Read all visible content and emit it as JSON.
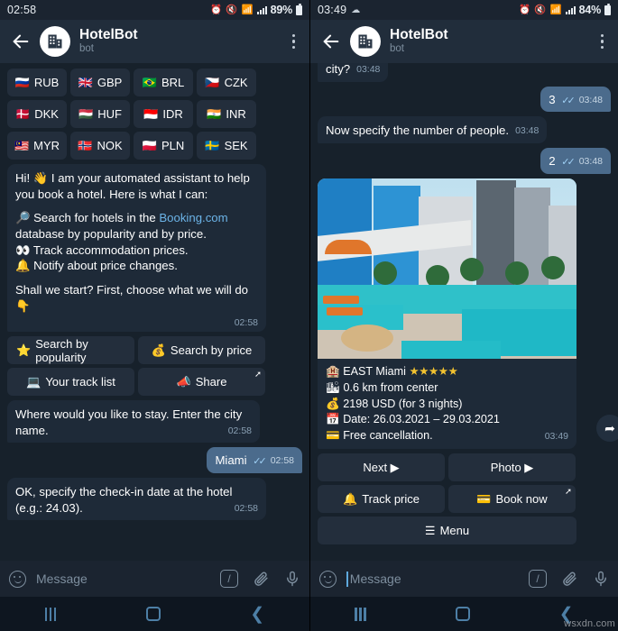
{
  "left": {
    "status_bar": {
      "clock": "02:58",
      "battery_pct": "89%",
      "icons": [
        "alarm-icon",
        "mute-icon",
        "wifi-icon",
        "signal-icon",
        "battery-icon"
      ]
    },
    "header": {
      "title": "HotelBot",
      "subtitle": "bot"
    },
    "currency_buttons": [
      {
        "flag": "🇷🇺",
        "label": "RUB"
      },
      {
        "flag": "🇬🇧",
        "label": "GBP"
      },
      {
        "flag": "🇧🇷",
        "label": "BRL"
      },
      {
        "flag": "🇨🇿",
        "label": "CZK"
      },
      {
        "flag": "🇩🇰",
        "label": "DKK"
      },
      {
        "flag": "🇭🇺",
        "label": "HUF"
      },
      {
        "flag": "🇮🇩",
        "label": "IDR"
      },
      {
        "flag": "🇮🇳",
        "label": "INR"
      },
      {
        "flag": "🇲🇾",
        "label": "MYR"
      },
      {
        "flag": "🇳🇴",
        "label": "NOK"
      },
      {
        "flag": "🇵🇱",
        "label": "PLN"
      },
      {
        "flag": "🇸🇪",
        "label": "SEK"
      }
    ],
    "intro_message": {
      "l1": "Hi! 👋 I am your automated assistant to help you book a hotel. Here is what I can:",
      "l2_pre": "🔎 Search for hotels in the ",
      "l2_link": "Booking.com",
      "l2_post": " database by popularity and by price.",
      "l3": "👀 Track accommodation prices.",
      "l4": "🔔 Notify about price changes.",
      "l5": "Shall we start? First, choose what we will do 👇",
      "time": "02:58"
    },
    "action_buttons": [
      {
        "icon": "⭐",
        "label": "Search by popularity",
        "corner": ""
      },
      {
        "icon": "💰",
        "label": "Search by price",
        "corner": ""
      },
      {
        "icon": "💻",
        "label": "Your track list",
        "corner": ""
      },
      {
        "icon": "📣",
        "label": "Share",
        "corner": "➚"
      }
    ],
    "messages": [
      {
        "from": "bot",
        "text": "Where would you like to stay. Enter the city name.",
        "time": "02:58"
      },
      {
        "from": "user",
        "text": "Miami",
        "time": "02:58"
      },
      {
        "from": "bot",
        "text": "OK, specify the check-in date at the hotel (e.g.: 24.03).",
        "time": "02:58"
      }
    ],
    "input": {
      "placeholder": "Message",
      "has_caret": false
    }
  },
  "right": {
    "status_bar": {
      "clock": "03:49",
      "battery_pct": "84%",
      "icons": [
        "cloud-icon",
        "alarm-icon",
        "mute-icon",
        "wifi-icon",
        "signal-icon",
        "battery-icon"
      ]
    },
    "header": {
      "title": "HotelBot",
      "subtitle": "bot"
    },
    "messages": [
      {
        "from": "bot",
        "text": "city?",
        "time": "03:48"
      },
      {
        "from": "user",
        "text": "3",
        "time": "03:48"
      },
      {
        "from": "bot",
        "text": "Now specify the number of people.",
        "time": "03:48"
      },
      {
        "from": "user",
        "text": "2",
        "time": "03:48"
      }
    ],
    "hotel_card": {
      "name_icon": "🏨",
      "name": "EAST Miami",
      "stars": "★★★★★",
      "distance_icon": "🏙",
      "distance": "0.6 km from center",
      "price_icon": "💰",
      "price": "2198 USD (for 3 nights)",
      "date_icon": "📅",
      "date": "Date: 26.03.2021 – 29.03.2021",
      "cancel_icon": "💳",
      "cancellation": "Free cancellation.",
      "time": "03:49",
      "forward_icon": "➦"
    },
    "action_buttons": [
      {
        "icon": "",
        "label": "Next ▶",
        "corner": ""
      },
      {
        "icon": "",
        "label": "Photo ▶",
        "corner": ""
      },
      {
        "icon": "🔔",
        "label": "Track price",
        "corner": ""
      },
      {
        "icon": "💳",
        "label": "Book now",
        "corner": "➚"
      },
      {
        "icon": "☰",
        "label": "Menu",
        "corner": ""
      }
    ],
    "input": {
      "placeholder": "Message",
      "has_caret": true
    }
  },
  "watermark": "wsxdn.com",
  "colors": {
    "bg": "#17212b",
    "header": "#212d3b",
    "bubble_in": "#1e2a38",
    "bubble_out": "#4b6b8c",
    "button": "#232e3c",
    "accent_link": "#6cb4e8",
    "nav_icon": "#4d7fa6"
  }
}
